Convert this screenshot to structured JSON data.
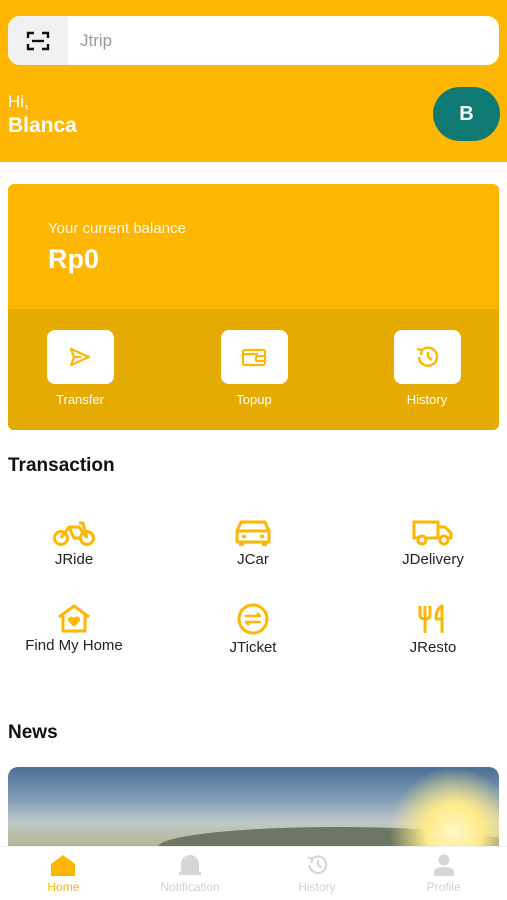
{
  "search": {
    "placeholder": "Jtrip"
  },
  "user": {
    "greeting": "Hi,",
    "name": "Blanca",
    "avatar_letter": "B"
  },
  "balance": {
    "label": "Your current balance",
    "amount": "Rp0",
    "actions": [
      {
        "label": "Transfer",
        "icon": "send-icon"
      },
      {
        "label": "Topup",
        "icon": "wallet-icon"
      },
      {
        "label": "History",
        "icon": "history-icon"
      }
    ]
  },
  "transaction": {
    "title": "Transaction",
    "services": [
      {
        "label": "JRide",
        "icon": "motorbike-icon"
      },
      {
        "label": "JCar",
        "icon": "car-icon"
      },
      {
        "label": "JDelivery",
        "icon": "truck-icon"
      },
      {
        "label": "Find My Home",
        "icon": "house-heart-icon"
      },
      {
        "label": "JTicket",
        "icon": "ticket-exchange-icon"
      },
      {
        "label": "JResto",
        "icon": "fork-knife-icon"
      }
    ]
  },
  "news": {
    "title": "News"
  },
  "nav": [
    {
      "label": "Home",
      "icon": "home-icon",
      "active": true
    },
    {
      "label": "Notification",
      "icon": "bell-icon",
      "active": false
    },
    {
      "label": "History",
      "icon": "history-icon",
      "active": false
    },
    {
      "label": "Profile",
      "icon": "person-icon",
      "active": false
    }
  ],
  "colors": {
    "primary": "#fdb702",
    "primary_dark": "#e6ab00",
    "avatar": "#0e7a73",
    "inactive": "#d0d0d0"
  }
}
